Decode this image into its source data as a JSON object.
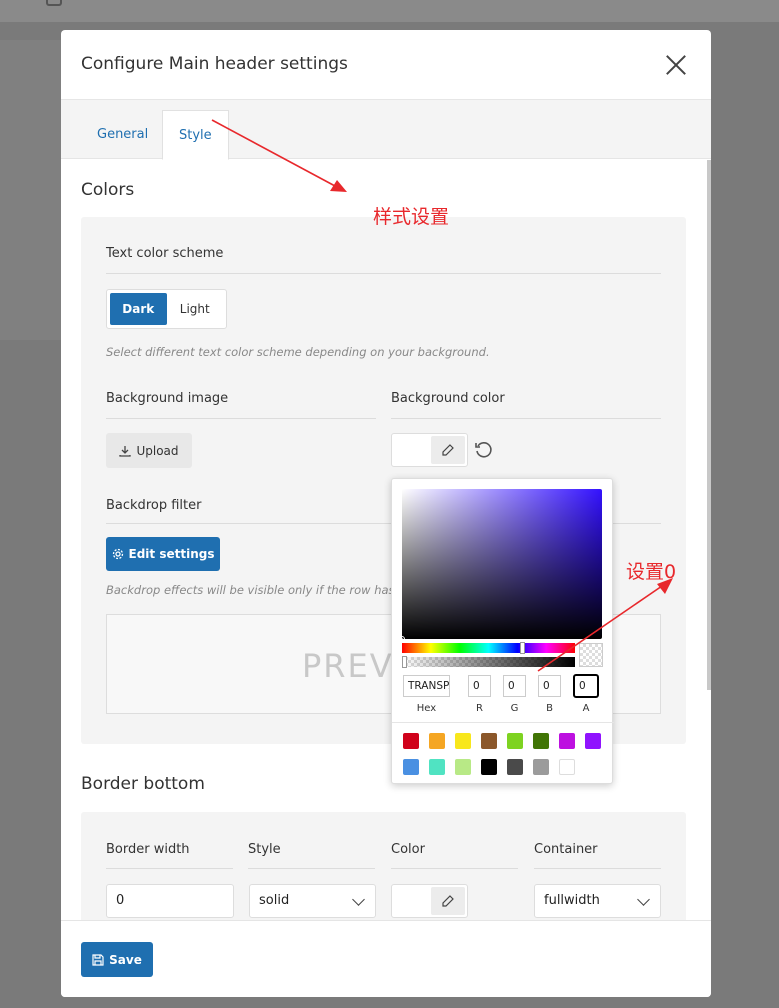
{
  "modal": {
    "title": "Configure Main header settings",
    "tabs": [
      {
        "label": "General"
      },
      {
        "label": "Style"
      }
    ]
  },
  "colors": {
    "title": "Colors",
    "text_color_scheme": {
      "label": "Text color scheme",
      "options": [
        "Dark",
        "Light"
      ],
      "hint": "Select different text color scheme depending on your background."
    },
    "background_image": {
      "label": "Background image",
      "upload_label": "Upload"
    },
    "background_color": {
      "label": "Background color"
    },
    "backdrop_filter": {
      "label": "Backdrop filter",
      "button_label": "Edit settings",
      "hint": "Backdrop effects will be visible only if the row has b",
      "preview_text": "PREV"
    }
  },
  "color_picker": {
    "hex_value": "TRANSPARENT",
    "r": "0",
    "g": "0",
    "b": "0",
    "a": "0",
    "labels": [
      "Hex",
      "R",
      "G",
      "B",
      "A"
    ],
    "swatches": [
      "#d0021b",
      "#f5a623",
      "#f8e71c",
      "#8b572a",
      "#7ed321",
      "#417505",
      "#bd10e0",
      "#9013fe",
      "#4a90e2",
      "#50e3c2",
      "#b8e986",
      "#000000",
      "#4a4a4a",
      "#9b9b9b",
      "#ffffff"
    ]
  },
  "border_bottom": {
    "title": "Border bottom",
    "columns": [
      "Border width",
      "Style",
      "Color",
      "Container"
    ],
    "width_value": "0",
    "style_value": "solid",
    "container_value": "fullwidth"
  },
  "footer": {
    "save_label": "Save"
  },
  "annotations": {
    "style_setting": "样式设置",
    "set_zero": "设置0"
  },
  "accent_color": "#1f6fb0",
  "annotation_color": "#e8282c"
}
